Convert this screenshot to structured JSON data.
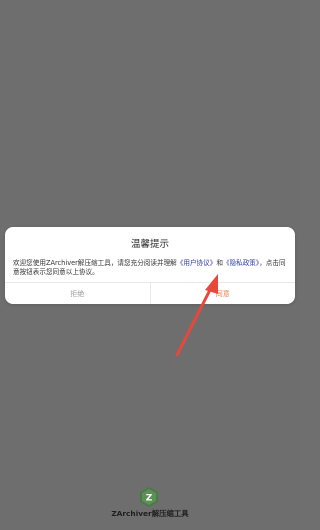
{
  "dialog": {
    "title": "温馨提示",
    "body_prefix": "欢迎您使用ZArchiver解压缩工具，请您充分阅读并理解",
    "user_agreement": "《用户协议》",
    "body_and": "和",
    "privacy_policy": "《隐私政策》",
    "body_suffix": "，点击同意按钮表示您同意以上协议。",
    "reject_label": "拒绝",
    "agree_label": "同意"
  },
  "annotation": {
    "arrow_color": "#e8473a"
  },
  "brand": {
    "name": "ZArchiver解压缩工具",
    "logo_letter": "Z",
    "logo_color": "#4a7a46"
  },
  "colors": {
    "overlay": "#6e6e6e",
    "agree": "#e87b4d",
    "link": "#2c3b9f"
  }
}
